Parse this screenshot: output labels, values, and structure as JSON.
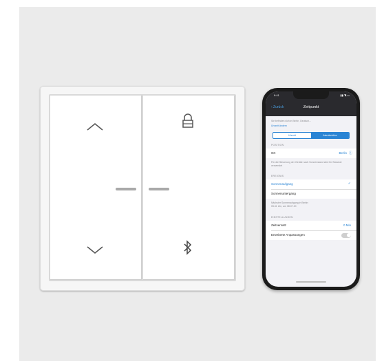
{
  "switch": {
    "left_rocker": {
      "top_symbol": "chevron-up",
      "bottom_symbol": "chevron-down"
    },
    "right_rocker": {
      "top_symbol": "lock",
      "bottom_symbol": "bluetooth"
    }
  },
  "phone": {
    "status_time": "9:41",
    "status_icons": "▮▮ ◥ ▭",
    "nav_back": "‹ Zurück",
    "nav_title": "Zeitpunkt",
    "intro_1": "Sie befinden sich in Berlin, Deutsch...",
    "intro_2": "Uhrzeit ändern",
    "segment_left": "Uhrzeit",
    "segment_right": "Astrofunktion",
    "section_position": "POSITION",
    "row_ort_label": "Ort",
    "row_ort_value": "Berlin",
    "hint_position": "Für die Steuerung der Geräte nach Sonnenstand wird Ihr Standort verwendet",
    "section_ereignis": "EREIGNIS",
    "row_sunrise": "Sonnenaufgang",
    "row_sunset": "Sonnenuntergang",
    "hint_ereignis_1": "Nächster Sonnenaufgang in Berlin:",
    "hint_ereignis_2": "05:41 Uhr, am 08.07.20",
    "section_einstellungen": "EINSTELLUNGEN",
    "row_offset_label": "Zeitversatz",
    "row_offset_value": "0 Min",
    "row_extended_label": "Erweiterte Anpassungen",
    "checkmark": "✓"
  }
}
